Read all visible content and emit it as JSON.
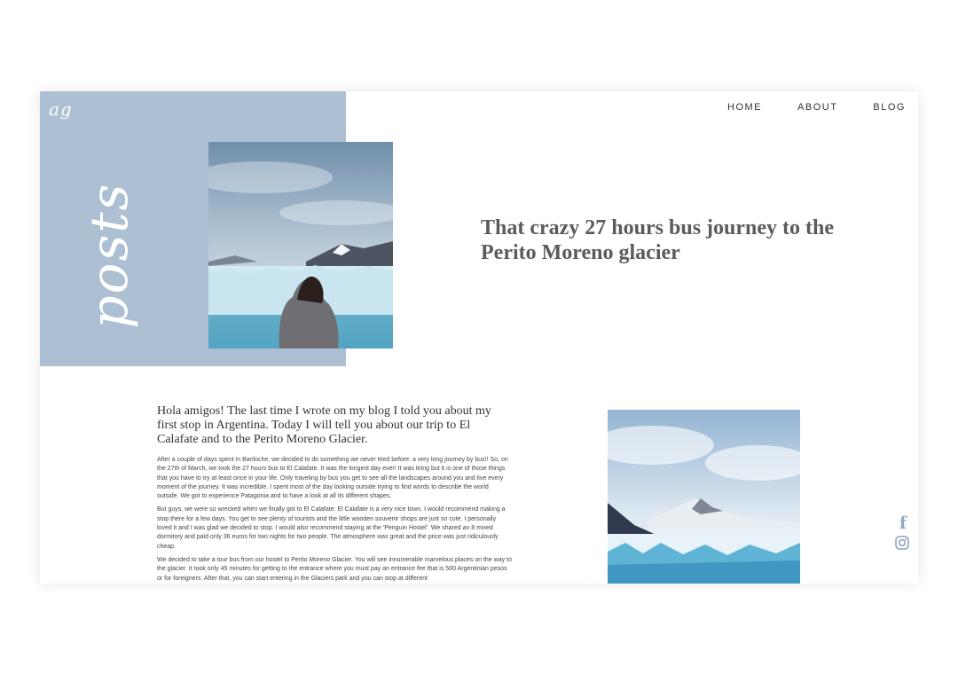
{
  "brand": {
    "logo_text": "ag",
    "section_word": "posts"
  },
  "nav": {
    "home": "HOME",
    "about": "ABOUT",
    "blog": "BLOG"
  },
  "post": {
    "title": "That crazy 27 hours bus journey to the Perito Moreno glacier",
    "intro": "Hola amigos! The last time I wrote on my blog I told you about my first stop in Argentina. Today I will tell you about our trip to El Calafate and to the Perito Moreno Glacier.",
    "paragraphs": [
      "After a couple of days spent in Bariloche, we decided to do something we never tried before: a very long journey by bus!! So, on the 27th of March, we took the 27 hours bus to El Calafate. It was the longest day ever! It was tiring but it is one of those things that you have to try at least once in your life. Only traveling by bus you get to see all the landscapes around you and live every moment of the journey. It was incredible. I spent most of the day looking outside trying to find words to describe the world outside. We got to experience Patagonia and to have a look at all its different shapes.",
      "But guys, we were so wrecked when we finally got to El Calafate. El Calafate is a very nice town. I would recommend making a stop there for a few days. You get to see plenty of tourists and the little wooden souvenir shops are just so cute. I personally loved it and I was glad we decided to stop. I would also recommend staying at the 'Penguin Hostel'. We shared an 8 mixed dormitory and paid only 36 euros for two nights for two people. The atmosphere was great and the price was just ridiculously cheap.",
      "We decided to take a tour bus from our hostel to Perito Moreno Glacier. You will see innumerable marvelous places on the way to the glacier. It took only 45 minutes for getting to the entrance where you must pay an entrance fee that is 500 Argentinian pesos or for foreigners. After that, you can start entering in the Glaciers park and you can stop at different"
    ]
  },
  "social": {
    "facebook_glyph": "f",
    "icons": [
      "facebook-icon",
      "instagram-icon"
    ]
  },
  "colors": {
    "panel": "#adc0d3",
    "title": "#5b5b5b",
    "social": "#8fa6bd"
  }
}
